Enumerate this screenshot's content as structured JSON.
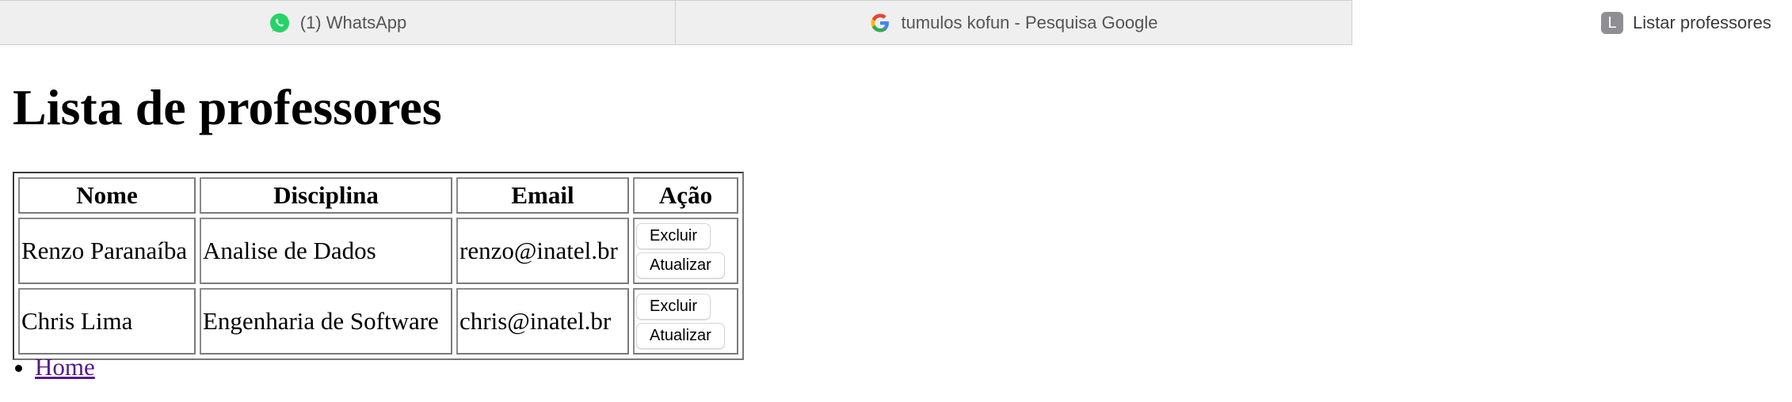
{
  "browser": {
    "tabs": [
      {
        "label": "(1) WhatsApp",
        "icon": "whatsapp-icon",
        "active": false
      },
      {
        "label": "tumulos kofun - Pesquisa Google",
        "icon": "google-icon",
        "active": false
      },
      {
        "label": "Listar professores",
        "icon": "letter-l-icon",
        "icon_letter": "L",
        "active": true
      }
    ]
  },
  "page": {
    "title": "Lista de professores",
    "table": {
      "headers": [
        "Nome",
        "Disciplina",
        "Email",
        "Ação"
      ],
      "rows": [
        {
          "nome": "Renzo Paranaíba",
          "disciplina": "Analise de Dados",
          "email": "renzo@inatel.br"
        },
        {
          "nome": "Chris Lima",
          "disciplina": "Engenharia de Software",
          "email": "chris@inatel.br"
        }
      ],
      "actions": {
        "delete_label": "Excluir",
        "update_label": "Atualizar"
      }
    },
    "nav": {
      "links": [
        {
          "label": "Home"
        }
      ]
    }
  },
  "colors": {
    "whatsapp_green": "#25D366",
    "link_visited": "#551a8b",
    "tab_strip_bg": "#efefef"
  }
}
